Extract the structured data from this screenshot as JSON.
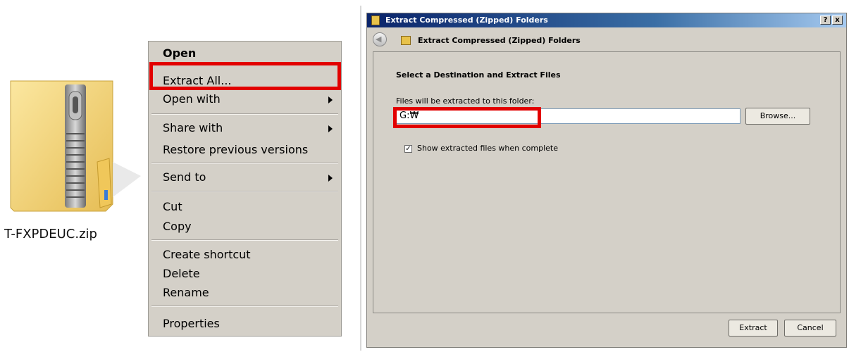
{
  "file": {
    "name": "T-FXPDEUC.zip",
    "icon": "zip-folder-icon"
  },
  "menu": {
    "items": [
      {
        "label": "Open",
        "bold": true,
        "submenu": false
      },
      {
        "label": "Extract All...",
        "bold": false,
        "submenu": false
      },
      {
        "label": "Open with",
        "bold": false,
        "submenu": true
      },
      {
        "label": "Share with",
        "bold": false,
        "submenu": true
      },
      {
        "label": "Restore previous versions",
        "bold": false,
        "submenu": false
      },
      {
        "label": "Send to",
        "bold": false,
        "submenu": true
      },
      {
        "label": "Cut",
        "bold": false,
        "submenu": false
      },
      {
        "label": "Copy",
        "bold": false,
        "submenu": false
      },
      {
        "label": "Create shortcut",
        "bold": false,
        "submenu": false
      },
      {
        "label": "Delete",
        "bold": false,
        "submenu": false
      },
      {
        "label": "Rename",
        "bold": false,
        "submenu": false
      },
      {
        "label": "Properties",
        "bold": false,
        "submenu": false
      }
    ]
  },
  "dialog": {
    "title": "Extract Compressed (Zipped) Folders",
    "nav_title": "Extract Compressed (Zipped) Folders",
    "heading": "Select a Destination and Extract Files",
    "folder_label": "Files will be extracted to this folder:",
    "path_value": "G:₩",
    "browse_label": "Browse...",
    "checkbox_label": "Show extracted files when complete",
    "checkbox_checked": true,
    "extract_label": "Extract",
    "cancel_label": "Cancel",
    "title_buttons": [
      "?",
      "x"
    ]
  },
  "colors": {
    "highlight": "#e20000",
    "menu_bg": "#d4d0c8",
    "titlebar": "#0a246a"
  }
}
